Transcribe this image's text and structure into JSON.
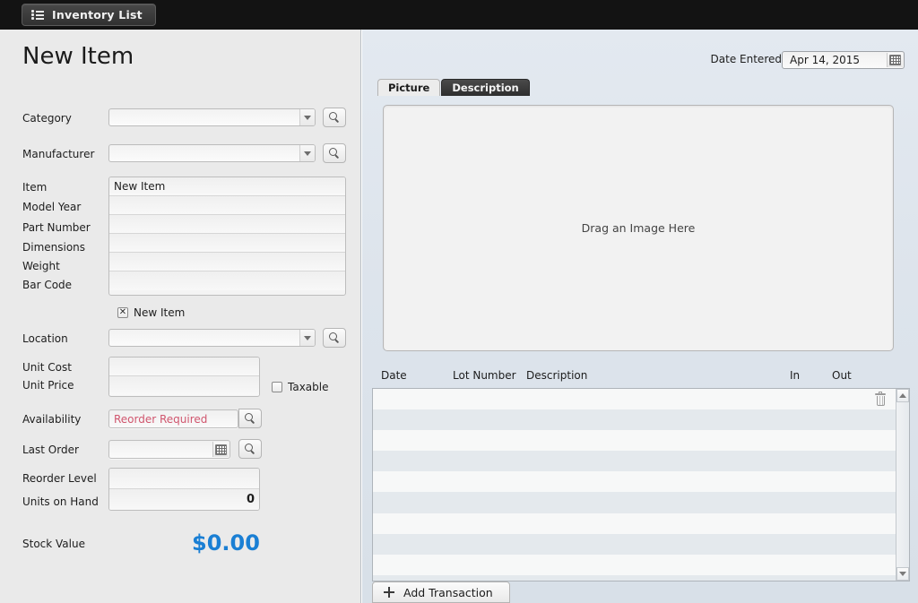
{
  "topbar": {
    "nav_button_label": "Inventory List",
    "nav_button_icon": "list-icon"
  },
  "left_form": {
    "title": "New Item",
    "category": {
      "label": "Category",
      "value": "",
      "search_icon": "search-icon",
      "dropdown_icon": "chevron-down-icon"
    },
    "manufacturer": {
      "label": "Manufacturer",
      "value": "",
      "search_icon": "search-icon",
      "dropdown_icon": "chevron-down-icon"
    },
    "item": {
      "label": "Item",
      "value": "New Item"
    },
    "model_year": {
      "label": "Model Year",
      "value": ""
    },
    "part_number": {
      "label": "Part Number",
      "value": ""
    },
    "dimensions": {
      "label": "Dimensions",
      "value": ""
    },
    "weight": {
      "label": "Weight",
      "value": ""
    },
    "bar_code": {
      "label": "Bar Code",
      "value": ""
    },
    "new_item_checkbox": {
      "label": "New Item",
      "checked": true,
      "mark": "✕"
    },
    "location": {
      "label": "Location",
      "value": "",
      "search_icon": "search-icon",
      "dropdown_icon": "chevron-down-icon"
    },
    "unit_cost": {
      "label": "Unit Cost",
      "value": ""
    },
    "unit_price": {
      "label": "Unit Price",
      "value": ""
    },
    "taxable_checkbox": {
      "label": "Taxable",
      "checked": false,
      "mark": ""
    },
    "availability": {
      "label": "Availability",
      "value": "Reorder Required",
      "value_color": "#d0566e",
      "search_icon": "search-icon"
    },
    "last_order": {
      "label": "Last Order",
      "value": "",
      "calendar_icon": "calendar-icon",
      "search_icon": "search-icon"
    },
    "reorder_level": {
      "label": "Reorder Level",
      "value": ""
    },
    "units_on_hand": {
      "label": "Units on Hand",
      "value": "0"
    },
    "stock_value": {
      "label": "Stock Value",
      "value": "$0.00",
      "value_color": "#1a7fd4"
    }
  },
  "right_panel": {
    "date_entered": {
      "label": "Date Entered",
      "value": "Apr 14, 2015",
      "calendar_icon": "calendar-icon"
    },
    "tabs": [
      {
        "label": "Picture",
        "state": "active"
      },
      {
        "label": "Description",
        "state": "hover"
      }
    ],
    "picture_dropzone": {
      "text": "Drag an Image Here"
    },
    "transactions": {
      "columns": [
        "Date",
        "Lot Number",
        "Description",
        "In",
        "Out"
      ],
      "rows": [],
      "row_count_visible": 9,
      "delete_icon": "trash-icon",
      "scroll_up_icon": "chevron-up-icon",
      "scroll_down_icon": "chevron-down-icon"
    },
    "add_transaction_button": {
      "label": "Add Transaction",
      "icon": "plus-icon"
    }
  }
}
